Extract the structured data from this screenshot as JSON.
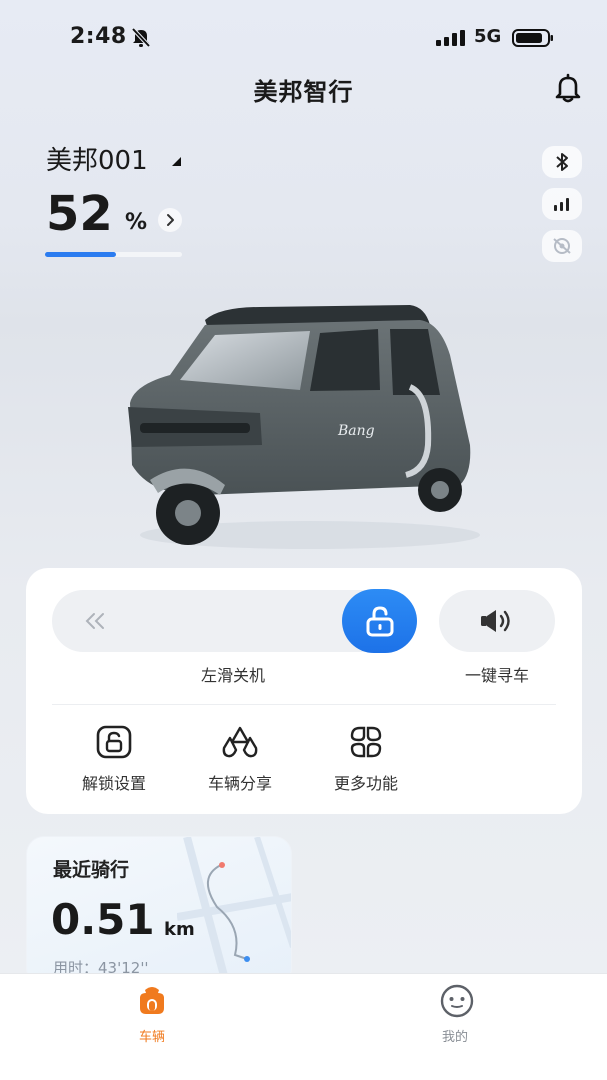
{
  "status_bar": {
    "time": "2:48",
    "network": "5G",
    "icons": [
      "bell-off-icon",
      "signal-icon",
      "battery-icon"
    ]
  },
  "header": {
    "title": "美邦智行",
    "notify_icon": "bell-icon"
  },
  "vehicle": {
    "name": "美邦001",
    "battery_value": "52",
    "battery_unit": "%",
    "battery_percent": 52,
    "side_icons": [
      "bluetooth-icon",
      "signal-bars-icon",
      "gps-off-icon"
    ]
  },
  "controls": {
    "slide_label": "左滑关机",
    "find_label": "一键寻车",
    "functions": [
      {
        "label": "解锁设置",
        "icon": "lock-settings-icon"
      },
      {
        "label": "车辆分享",
        "icon": "share-icon"
      },
      {
        "label": "更多功能",
        "icon": "more-grid-icon"
      }
    ]
  },
  "recent_ride": {
    "title": "最近骑行",
    "distance": "0.51",
    "unit": "km",
    "duration_label": "用时：",
    "duration": "43'12''"
  },
  "tab_bar": {
    "tabs": [
      {
        "label": "车辆",
        "active": true,
        "icon": "scooter-icon"
      },
      {
        "label": "我的",
        "active": false,
        "icon": "smiley-icon"
      }
    ]
  },
  "colors": {
    "accent": "#2b7cf0",
    "tab_active": "#f07a1e",
    "tab_inactive": "#8a8f96"
  }
}
